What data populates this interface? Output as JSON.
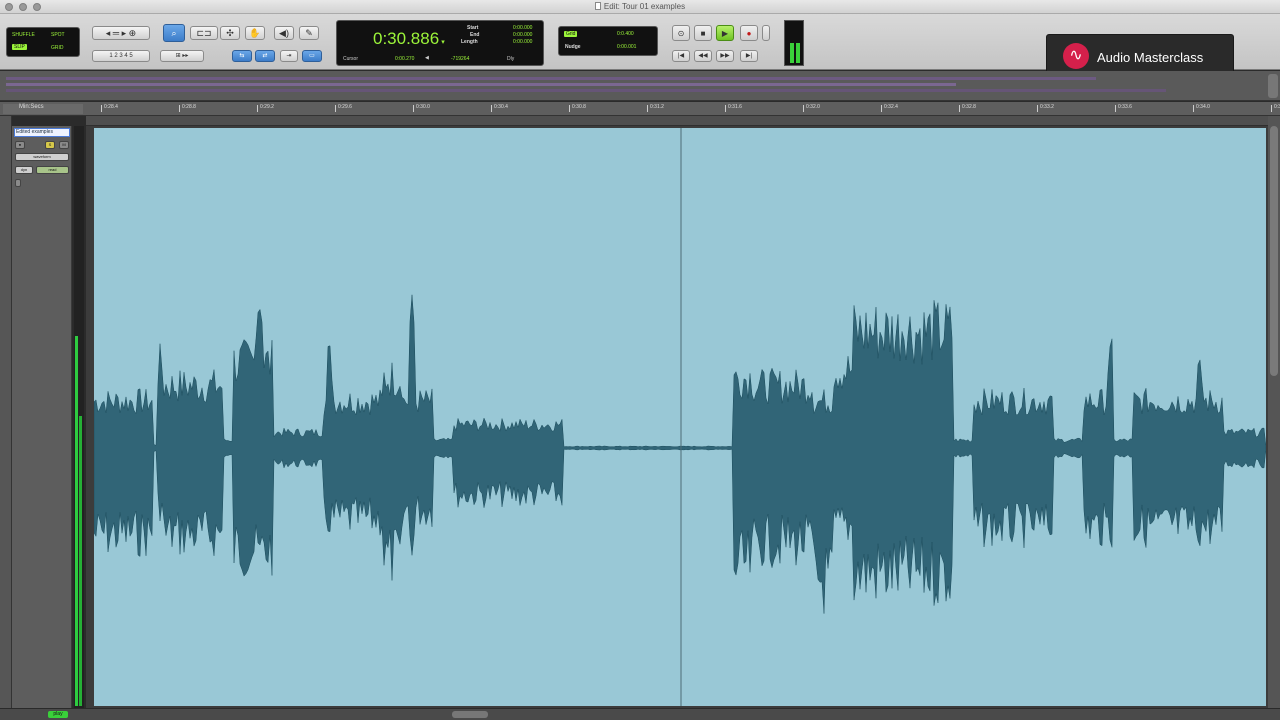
{
  "window": {
    "title": "Edit: Tour 01 examples"
  },
  "edit_modes": {
    "shuffle": "SHUFFLE",
    "spot": "SPOT",
    "slip": "SLIP",
    "grid": "GRID"
  },
  "counter": {
    "main": "0:30.886",
    "start_label": "Start",
    "end_label": "End",
    "length_label": "Length",
    "start_value": "0:00.000",
    "end_value": "0:00.000",
    "length_value": "0:00.000",
    "cursor_label": "Cursor",
    "cursor_value": "0:00.270",
    "sample_value": "-719264",
    "dly_label": "Dly"
  },
  "grid_nudge": {
    "grid_label": "Grid",
    "grid_value": "0:0.400",
    "nudge_label": "Nudge",
    "nudge_value": "0:00.001"
  },
  "logo": {
    "text": "Audio Masterclass",
    "mark": "∿"
  },
  "ruler": {
    "label": "Min:Secs",
    "ticks": [
      "0:28.4",
      "0:28.8",
      "0:29.2",
      "0:29.6",
      "0:30.0",
      "0:30.4",
      "0:30.8",
      "0:31.2",
      "0:31.6",
      "0:32.0",
      "0:32.4",
      "0:32.8",
      "0:33.2",
      "0:33.6",
      "0:34.0",
      "0:34.4"
    ]
  },
  "track": {
    "name": "Edited examples",
    "view": "waveform",
    "state_labels": [
      "S",
      "M"
    ],
    "dyn_label": "dyn",
    "read_label": "read"
  },
  "bottom": {
    "play_label": "play"
  },
  "colors": {
    "clip_bg": "#99c8d6",
    "waveform": "#1f5466",
    "lcd_green": "#9cf53a",
    "play_green": "#6fc224",
    "logo_red": "#d5204b"
  }
}
